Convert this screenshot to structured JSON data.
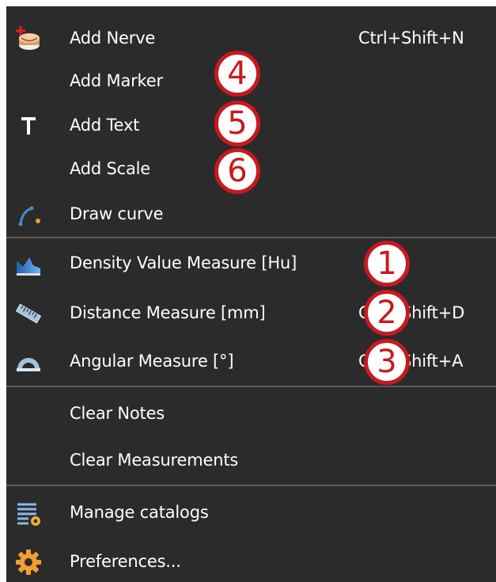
{
  "menu": {
    "items": [
      {
        "label": "Add Nerve",
        "shortcut": "Ctrl+Shift+N",
        "icon": "nerve-icon"
      },
      {
        "label": "Add Marker",
        "shortcut": "",
        "icon": ""
      },
      {
        "label": "Add Text",
        "shortcut": "",
        "icon": "text-icon"
      },
      {
        "label": "Add Scale",
        "shortcut": "",
        "icon": ""
      },
      {
        "label": "Draw curve",
        "shortcut": "",
        "icon": "curve-icon"
      },
      {
        "label": "Density Value Measure [Hu]",
        "shortcut": "",
        "icon": "density-icon"
      },
      {
        "label": "Distance Measure [mm]",
        "shortcut": "Ctrl+Shift+D",
        "icon": "ruler-icon"
      },
      {
        "label": "Angular Measure [°]",
        "shortcut": "Ctrl+Shift+A",
        "icon": "protractor-icon"
      },
      {
        "label": "Clear Notes",
        "shortcut": "",
        "icon": ""
      },
      {
        "label": "Clear Measurements",
        "shortcut": "",
        "icon": ""
      },
      {
        "label": "Manage catalogs",
        "shortcut": "",
        "icon": "catalog-icon"
      },
      {
        "label": "Preferences...",
        "shortcut": "",
        "icon": "gear-icon"
      }
    ]
  },
  "callouts": [
    "4",
    "5",
    "6",
    "1",
    "2",
    "3"
  ],
  "colors": {
    "menu_background": "#2b2b2b",
    "menu_text": "#ffffff",
    "separator": "#5a5a5a",
    "callout_red": "#c8191e"
  }
}
